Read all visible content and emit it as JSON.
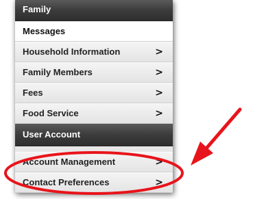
{
  "menu": {
    "family_header": "Family",
    "family_items": [
      {
        "label": "Messages",
        "chevron": ""
      },
      {
        "label": "Household Information",
        "chevron": ">"
      },
      {
        "label": "Family Members",
        "chevron": ">"
      },
      {
        "label": "Fees",
        "chevron": ">"
      },
      {
        "label": "Food Service",
        "chevron": ">"
      }
    ],
    "account_header": "User Account",
    "account_items": [
      {
        "label": "Account Management",
        "chevron": ">"
      },
      {
        "label": "Contact Preferences",
        "chevron": ">"
      }
    ]
  },
  "annotation": {
    "color": "#e8141b",
    "shape": "ellipse-with-arrow"
  }
}
